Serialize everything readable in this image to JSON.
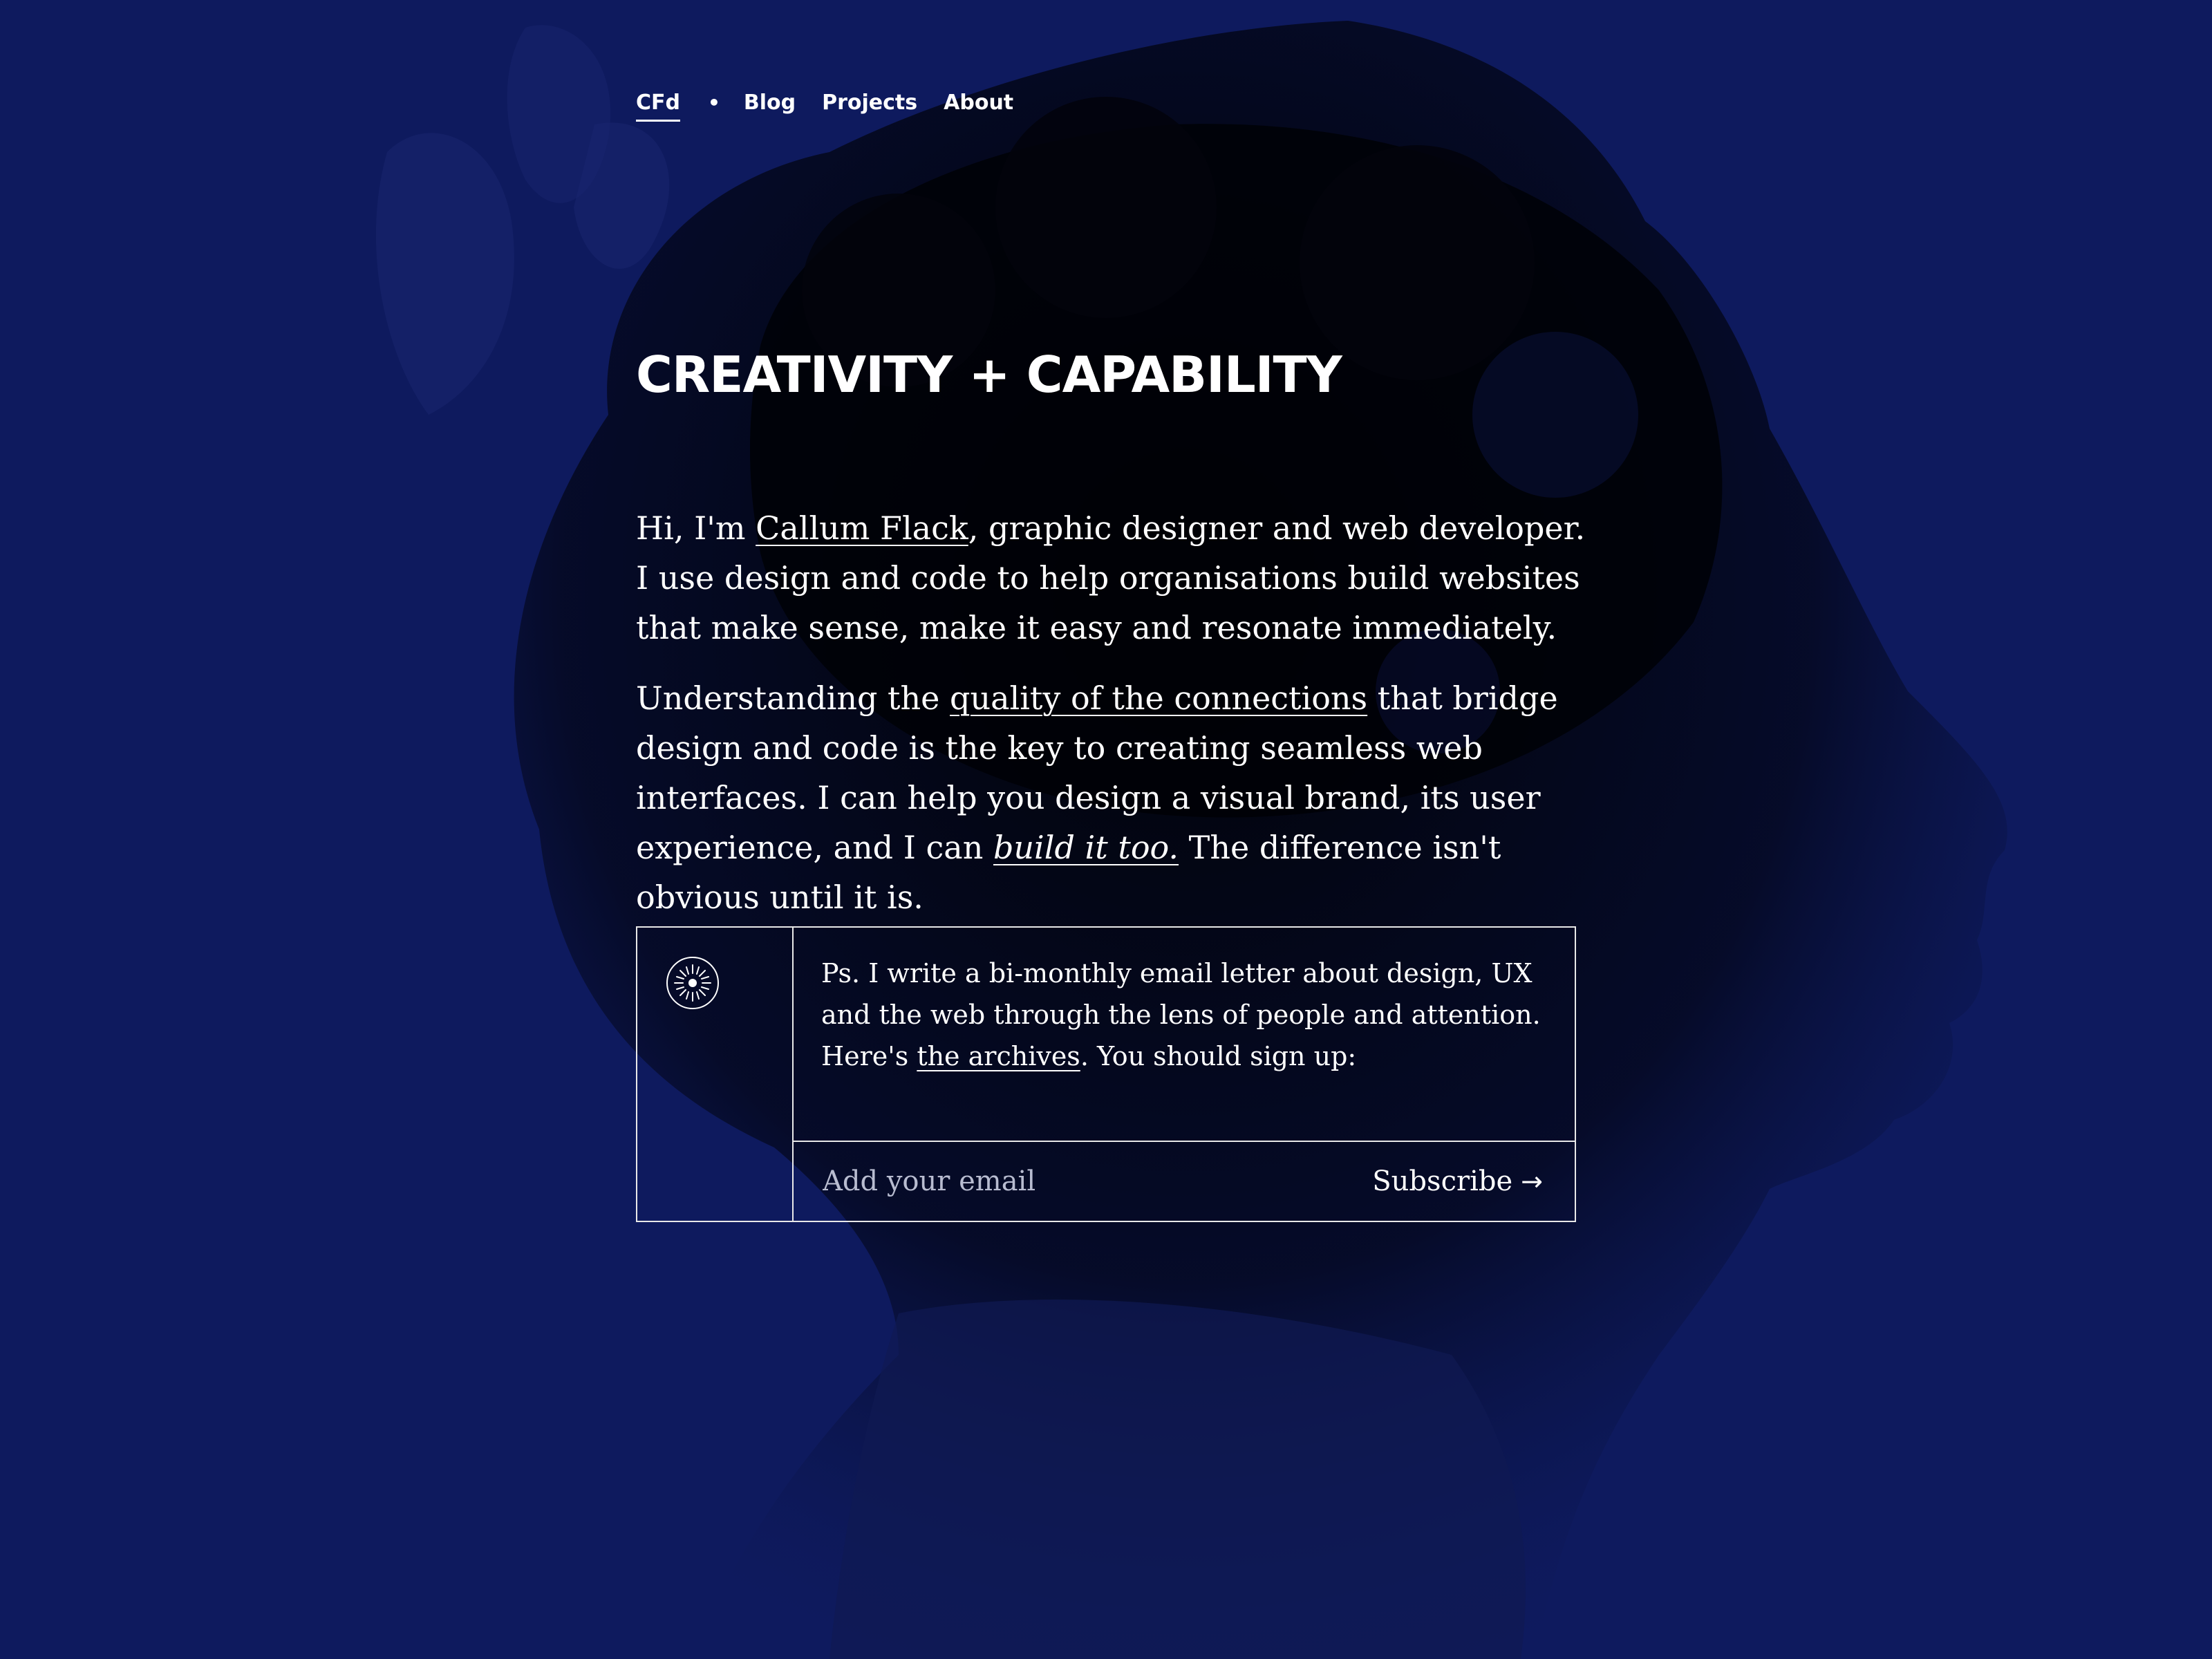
{
  "nav": {
    "logo": "CFd",
    "separator": "•",
    "links": [
      "Blog",
      "Projects",
      "About"
    ]
  },
  "hero": {
    "title": "CREATIVITY + CAPABILITY"
  },
  "intro": {
    "p1_lead": "Hi, I'm ",
    "p1_link": "Callum Flack",
    "p1_rest": ", graphic designer and web developer. I use design and code to help organisations build websites that make sense, make it easy and resonate immediately.",
    "p2_lead": "Understanding the ",
    "p2_link": "quality of the connections",
    "p2_mid": " that bridge design and code is the key to creating seamless web interfaces. I can help you design a visual brand, its user experience, and I can ",
    "p2_em_link": "build it too.",
    "p2_end": " The difference isn't obvious until it is."
  },
  "newsletter": {
    "badge_icon": "sun-burst-icon",
    "line1": "Ps. I write a bi-monthly email letter about design, UX and the web through the lens of people and attention.",
    "line2_lead": "Here's ",
    "line2_link": "the archives",
    "line2_end": ". You should sign up:",
    "email_placeholder": "Add your email",
    "subscribe_label": "Subscribe",
    "subscribe_arrow": "→"
  },
  "colors": {
    "background": "#0e1a5e",
    "silhouette": "#030513",
    "text": "#ffffff"
  }
}
